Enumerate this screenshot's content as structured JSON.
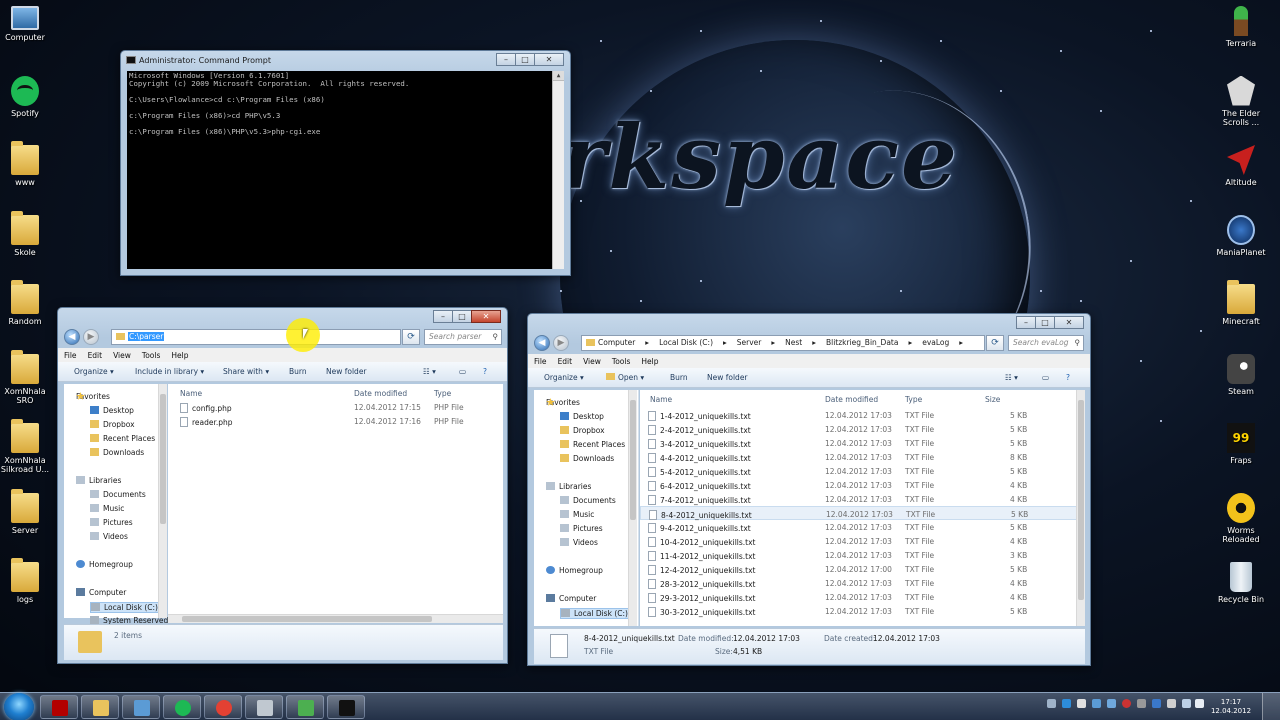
{
  "desktop": {
    "left_icons": [
      {
        "label": "Computer",
        "icon": "computer-icon"
      },
      {
        "label": "Spotify",
        "icon": "spotify-icon"
      },
      {
        "label": "www",
        "icon": "folder-icon"
      },
      {
        "label": "Skole",
        "icon": "folder-icon"
      },
      {
        "label": "Random",
        "icon": "folder-icon"
      },
      {
        "label": "XomNhala SRO",
        "icon": "folder-icon"
      },
      {
        "label": "XomNhala Silkroad U...",
        "icon": "folder-icon"
      },
      {
        "label": "Server",
        "icon": "folder-icon"
      },
      {
        "label": "logs",
        "icon": "folder-icon"
      }
    ],
    "right_icons": [
      {
        "label": "Terraria",
        "icon": "terraria-icon"
      },
      {
        "label": "The Elder Scrolls ...",
        "icon": "skyrim-icon"
      },
      {
        "label": "Altitude",
        "icon": "altitude-icon"
      },
      {
        "label": "ManiaPlanet",
        "icon": "maniaplanet-icon"
      },
      {
        "label": "Minecraft",
        "icon": "folder-icon"
      },
      {
        "label": "Steam",
        "icon": "steam-icon"
      },
      {
        "label": "Fraps",
        "icon": "fraps-icon",
        "glyph": "99"
      },
      {
        "label": "Worms Reloaded",
        "icon": "worms-icon"
      },
      {
        "label": "Recycle Bin",
        "icon": "recycle-bin-icon"
      }
    ],
    "wallpaper_text": "rkspace"
  },
  "cmd": {
    "title": "Administrator: Command Prompt",
    "lines": [
      "Microsoft Windows [Version 6.1.7601]",
      "Copyright (c) 2009 Microsoft Corporation.  All rights reserved.",
      "",
      "C:\\Users\\Flowlance>cd c:\\Program Files (x86)",
      "",
      "c:\\Program Files (x86)>cd PHP\\v5.3",
      "",
      "c:\\Program Files (x86)\\PHP\\v5.3>php-cgi.exe"
    ]
  },
  "explorer1": {
    "address": "C:\\parser",
    "search_placeholder": "Search parser",
    "menu": [
      "File",
      "Edit",
      "View",
      "Tools",
      "Help"
    ],
    "toolbar": {
      "organize": "Organize",
      "include": "Include in library",
      "share": "Share with",
      "burn": "Burn",
      "new_folder": "New folder"
    },
    "nav": {
      "favorites": "Favorites",
      "fav_items": [
        "Desktop",
        "Dropbox",
        "Recent Places",
        "Downloads"
      ],
      "libraries": "Libraries",
      "lib_items": [
        "Documents",
        "Music",
        "Pictures",
        "Videos"
      ],
      "homegroup": "Homegroup",
      "computer": "Computer",
      "drives": [
        "Local Disk (C:)",
        "System Reserved"
      ]
    },
    "columns": {
      "name": "Name",
      "date": "Date modified",
      "type": "Type"
    },
    "files": [
      {
        "name": "config.php",
        "date": "12.04.2012 17:15",
        "type": "PHP File"
      },
      {
        "name": "reader.php",
        "date": "12.04.2012 17:16",
        "type": "PHP File"
      }
    ],
    "status": "2 items"
  },
  "explorer2": {
    "breadcrumbs": [
      "Computer",
      "Local Disk (C:)",
      "Server",
      "Nest",
      "Blitzkrieg_Bin_Data",
      "evaLog"
    ],
    "search_placeholder": "Search evaLog",
    "menu": [
      "File",
      "Edit",
      "View",
      "Tools",
      "Help"
    ],
    "toolbar": {
      "organize": "Organize",
      "open": "Open",
      "burn": "Burn",
      "new_folder": "New folder"
    },
    "nav": {
      "favorites": "Favorites",
      "fav_items": [
        "Desktop",
        "Dropbox",
        "Recent Places",
        "Downloads"
      ],
      "libraries": "Libraries",
      "lib_items": [
        "Documents",
        "Music",
        "Pictures",
        "Videos"
      ],
      "homegroup": "Homegroup",
      "computer": "Computer",
      "drives": [
        "Local Disk (C:)"
      ]
    },
    "columns": {
      "name": "Name",
      "date": "Date modified",
      "type": "Type",
      "size": "Size"
    },
    "files": [
      {
        "name": "1-4-2012_uniquekills.txt",
        "date": "12.04.2012 17:03",
        "type": "TXT File",
        "size": "5 KB"
      },
      {
        "name": "2-4-2012_uniquekills.txt",
        "date": "12.04.2012 17:03",
        "type": "TXT File",
        "size": "5 KB"
      },
      {
        "name": "3-4-2012_uniquekills.txt",
        "date": "12.04.2012 17:03",
        "type": "TXT File",
        "size": "5 KB"
      },
      {
        "name": "4-4-2012_uniquekills.txt",
        "date": "12.04.2012 17:03",
        "type": "TXT File",
        "size": "8 KB"
      },
      {
        "name": "5-4-2012_uniquekills.txt",
        "date": "12.04.2012 17:03",
        "type": "TXT File",
        "size": "5 KB"
      },
      {
        "name": "6-4-2012_uniquekills.txt",
        "date": "12.04.2012 17:03",
        "type": "TXT File",
        "size": "4 KB"
      },
      {
        "name": "7-4-2012_uniquekills.txt",
        "date": "12.04.2012 17:03",
        "type": "TXT File",
        "size": "4 KB"
      },
      {
        "name": "8-4-2012_uniquekills.txt",
        "date": "12.04.2012 17:03",
        "type": "TXT File",
        "size": "5 KB",
        "selected": true
      },
      {
        "name": "9-4-2012_uniquekills.txt",
        "date": "12.04.2012 17:03",
        "type": "TXT File",
        "size": "5 KB"
      },
      {
        "name": "10-4-2012_uniquekills.txt",
        "date": "12.04.2012 17:03",
        "type": "TXT File",
        "size": "4 KB"
      },
      {
        "name": "11-4-2012_uniquekills.txt",
        "date": "12.04.2012 17:03",
        "type": "TXT File",
        "size": "3 KB"
      },
      {
        "name": "12-4-2012_uniquekills.txt",
        "date": "12.04.2012 17:00",
        "type": "TXT File",
        "size": "5 KB"
      },
      {
        "name": "28-3-2012_uniquekills.txt",
        "date": "12.04.2012 17:03",
        "type": "TXT File",
        "size": "4 KB"
      },
      {
        "name": "29-3-2012_uniquekills.txt",
        "date": "12.04.2012 17:03",
        "type": "TXT File",
        "size": "4 KB"
      },
      {
        "name": "30-3-2012_uniquekills.txt",
        "date": "12.04.2012 17:03",
        "type": "TXT File",
        "size": "5 KB"
      }
    ],
    "details": {
      "name": "8-4-2012_uniquekills.txt",
      "modified_label": "Date modified:",
      "modified": "12.04.2012 17:03",
      "created_label": "Date created:",
      "created": "12.04.2012 17:03",
      "type": "TXT File",
      "size_label": "Size:",
      "size": "4,51 KB"
    }
  },
  "taskbar": {
    "apps": [
      "filezilla-icon",
      "explorer-icon",
      "network-icon",
      "spotify-icon",
      "chrome-icon",
      "tools-icon",
      "notepad-icon",
      "cmd-icon"
    ],
    "clock_time": "17:17",
    "clock_date": "12.04.2012"
  }
}
